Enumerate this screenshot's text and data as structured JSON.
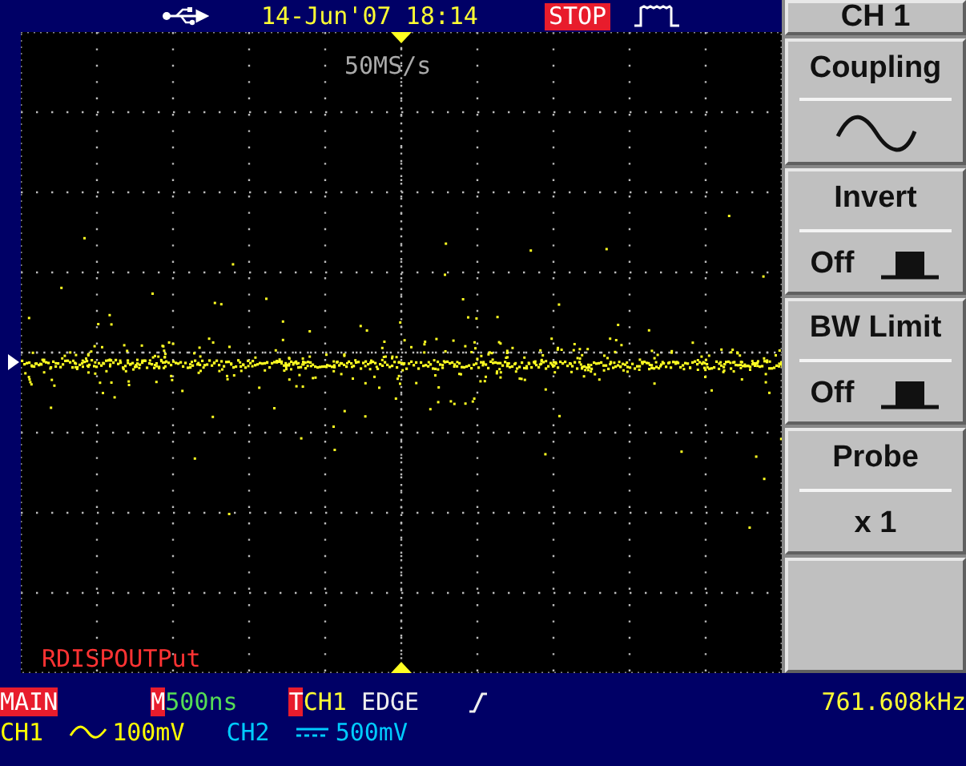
{
  "status_bar": {
    "datetime": "14-Jun'07 18:14",
    "run_state": "STOP"
  },
  "screen": {
    "sample_rate": "50MS/s",
    "label": "RDISPOUTPut"
  },
  "menu": {
    "title": "CH 1",
    "items": [
      {
        "label": "Coupling",
        "kind": "wave"
      },
      {
        "label": "Invert",
        "kind": "toggle",
        "value": "Off"
      },
      {
        "label": "BW Limit",
        "kind": "toggle",
        "value": "Off"
      },
      {
        "label": "Probe",
        "kind": "text",
        "value": "x 1"
      }
    ]
  },
  "info": {
    "mode": "MAIN",
    "timebase_badge": "M",
    "timebase": "500ns",
    "trigger_badge": "T",
    "trigger_source": "CH1",
    "trigger_type": "EDGE",
    "frequency": "761.608kHz"
  },
  "channels": [
    {
      "name": "CH1",
      "kind": "ac",
      "scale": "100mV",
      "color": "#ffff00"
    },
    {
      "name": "CH2",
      "kind": "dc",
      "scale": "500mV",
      "color": "#00ccff"
    }
  ]
}
